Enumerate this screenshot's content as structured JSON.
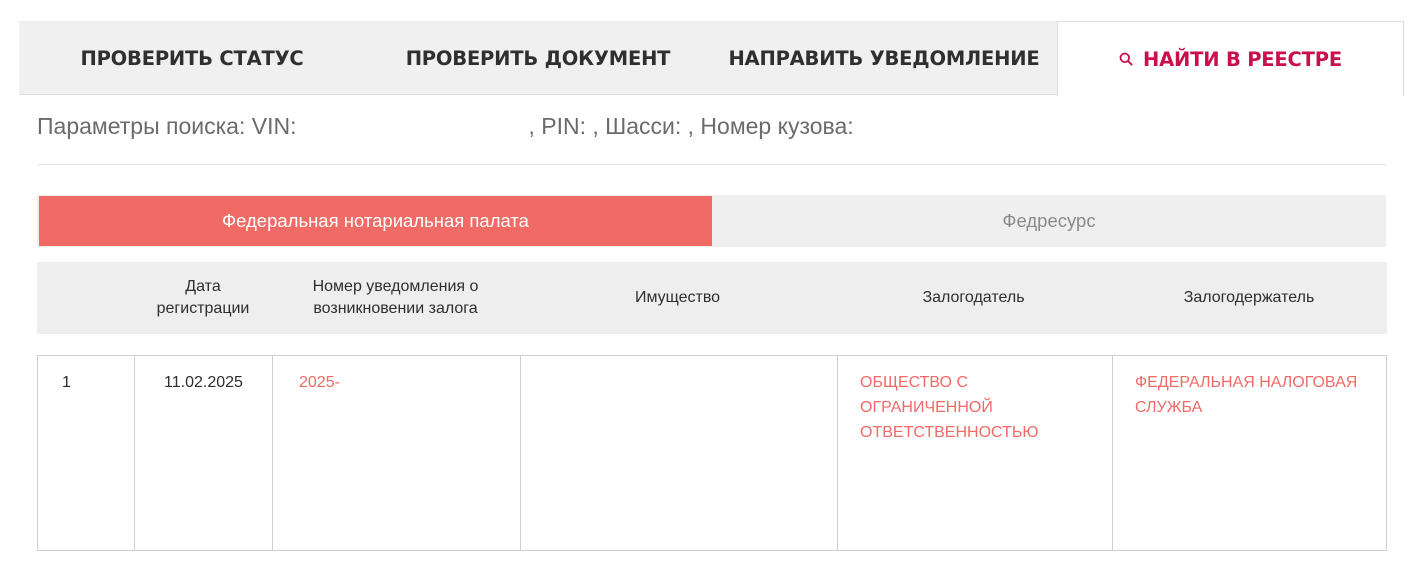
{
  "tabs": [
    {
      "label": "ПРОВЕРИТЬ СТАТУС"
    },
    {
      "label": "ПРОВЕРИТЬ ДОКУМЕНТ"
    },
    {
      "label": "НАПРАВИТЬ УВЕДОМЛЕНИЕ"
    },
    {
      "label": "НАЙТИ В РЕЕСТРЕ",
      "icon": "search-icon",
      "active": true
    }
  ],
  "search_params": {
    "prefix": "Параметры поиска: VIN:",
    "rest": ", PIN: , Шасси: , Номер кузова:"
  },
  "sources": [
    {
      "label": "Федеральная нотариальная палата",
      "active": true
    },
    {
      "label": "Федресурс",
      "active": false
    }
  ],
  "table": {
    "headers": {
      "date": "Дата регистрации",
      "number": "Номер уведомления о возникновении залога",
      "property": "Имущество",
      "pledgor": "Залогодатель",
      "pledgee": "Залогодержатель"
    },
    "rows": [
      {
        "index": "1",
        "date": "11.02.2025",
        "number": "2025-",
        "property": "",
        "pledgor": "ОБЩЕСТВО С ОГРАНИЧЕННОЙ ОТВЕТСТВЕННОСТЬЮ",
        "pledgee": "ФЕДЕРАЛЬНАЯ НАЛОГОВАЯ СЛУЖБА"
      }
    ]
  },
  "colors": {
    "accent": "#c8104a",
    "source_active": "#f06a66",
    "link": "#f06a66",
    "tab_bg": "#f0f0f0"
  }
}
